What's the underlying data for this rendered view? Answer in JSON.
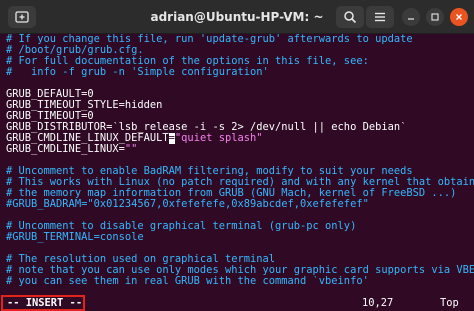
{
  "window": {
    "title": "adrian@Ubuntu-HP-VM: ~"
  },
  "icons": {
    "new_tab": "new-tab-icon",
    "search": "search-icon",
    "menu": "hamburger-menu-icon",
    "minimize": "minimize-icon",
    "maximize": "maximize-icon",
    "close": "close-icon"
  },
  "colors": {
    "background": "#300a24",
    "comment": "#34b7ff",
    "string": "#f77ff0",
    "text": "#ffffff",
    "close_button": "#e95420",
    "highlight_box": "#e2231a"
  },
  "editor": {
    "lines": [
      {
        "parts": [
          {
            "type": "comment",
            "text": "# If you change this file, run 'update-grub' afterwards to update"
          }
        ]
      },
      {
        "parts": [
          {
            "type": "comment",
            "text": "# /boot/grub/grub.cfg."
          }
        ]
      },
      {
        "parts": [
          {
            "type": "comment",
            "text": "# For full documentation of the options in this file, see:"
          }
        ]
      },
      {
        "parts": [
          {
            "type": "comment",
            "text": "#   info -f grub -n 'Simple configuration'"
          }
        ]
      },
      {
        "parts": []
      },
      {
        "parts": [
          {
            "type": "plain",
            "text": "GRUB_DEFAULT=0"
          }
        ]
      },
      {
        "parts": [
          {
            "type": "plain",
            "text": "GRUB_TIMEOUT_STYLE=hidden"
          }
        ]
      },
      {
        "parts": [
          {
            "type": "plain",
            "text": "GRUB_TIMEOUT=0"
          }
        ]
      },
      {
        "parts": [
          {
            "type": "plain",
            "text": "GRUB_DISTRIBUTOR=`lsb_release -i -s 2> /dev/null || echo Debian`"
          }
        ]
      },
      {
        "parts": [
          {
            "type": "plain",
            "text": "GRUB_CMDLINE_LINUX_DEFAULT"
          },
          {
            "type": "cursor",
            "text": "="
          },
          {
            "type": "string",
            "text": "\"quiet splash\""
          }
        ]
      },
      {
        "parts": [
          {
            "type": "plain",
            "text": "GRUB_CMDLINE_LINUX="
          },
          {
            "type": "string",
            "text": "\"\""
          }
        ]
      },
      {
        "parts": []
      },
      {
        "parts": [
          {
            "type": "comment",
            "text": "# Uncomment to enable BadRAM filtering, modify to suit your needs"
          }
        ]
      },
      {
        "parts": [
          {
            "type": "comment",
            "text": "# This works with Linux (no patch required) and with any kernel that obtains"
          }
        ]
      },
      {
        "parts": [
          {
            "type": "comment",
            "text": "# the memory map information from GRUB (GNU Mach, kernel of FreeBSD ...)"
          }
        ]
      },
      {
        "parts": [
          {
            "type": "comment",
            "text": "#GRUB_BADRAM=\"0x01234567,0xfefefefe,0x89abcdef,0xefefefef\""
          }
        ]
      },
      {
        "parts": []
      },
      {
        "parts": [
          {
            "type": "comment",
            "text": "# Uncomment to disable graphical terminal (grub-pc only)"
          }
        ]
      },
      {
        "parts": [
          {
            "type": "comment",
            "text": "#GRUB_TERMINAL=console"
          }
        ]
      },
      {
        "parts": []
      },
      {
        "parts": [
          {
            "type": "comment",
            "text": "# The resolution used on graphical terminal"
          }
        ]
      },
      {
        "parts": [
          {
            "type": "comment",
            "text": "# note that you can use only modes which your graphic card supports via VBE"
          }
        ]
      },
      {
        "parts": [
          {
            "type": "comment",
            "text": "# you can see them in real GRUB with the command `vbeinfo'"
          }
        ]
      }
    ]
  },
  "status": {
    "mode": "-- INSERT --",
    "position": "10,27",
    "scroll": "Top"
  }
}
